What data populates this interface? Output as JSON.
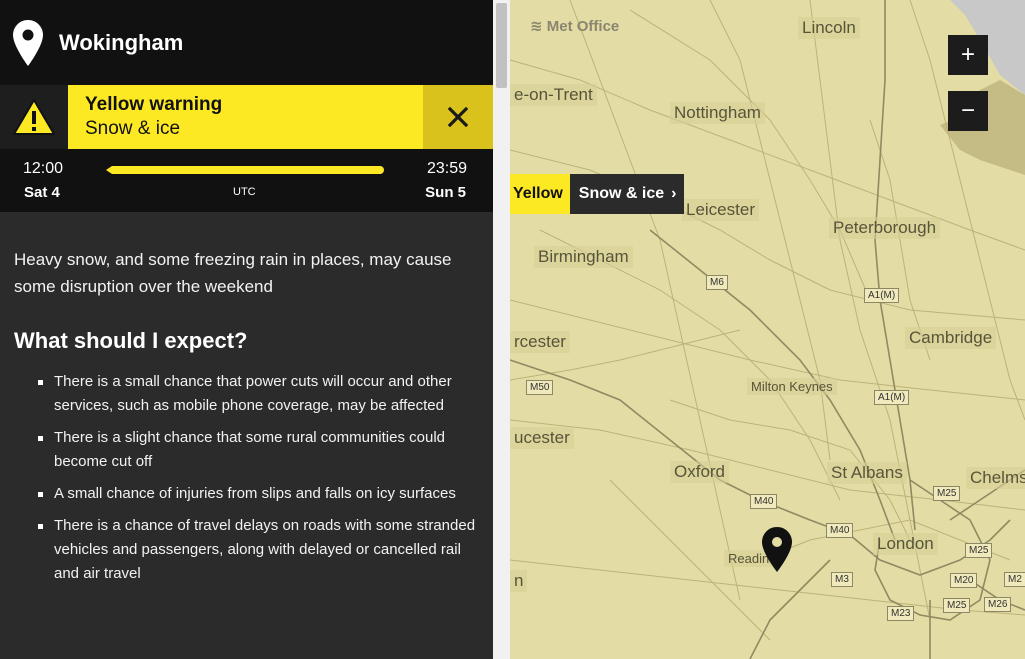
{
  "location": {
    "name": "Wokingham",
    "icon": "map-pin-icon"
  },
  "warning": {
    "level": "Yellow warning",
    "type": "Snow & ice",
    "icon": "warning-triangle-icon",
    "close_icon": "close-icon",
    "color": "#fde824"
  },
  "timeline": {
    "start_time": "12:00",
    "start_day": "Sat 4",
    "end_time": "23:59",
    "end_day": "Sun 5",
    "timezone": "UTC"
  },
  "summary": "Heavy snow, and some freezing rain in places, may cause some disruption over the weekend",
  "expect": {
    "heading": "What should I expect?",
    "items": [
      "There is a small chance that power cuts will occur and other services, such as mobile phone coverage, may be affected",
      "There is a slight chance that some rural communities could become cut off",
      "A small chance of injuries from slips and falls on icy surfaces",
      "There is a chance of travel delays on roads with some stranded vehicles and passengers, along with delayed or cancelled rail and air travel"
    ]
  },
  "map": {
    "brand": "Met Office",
    "zoom_in": "+",
    "zoom_out": "−",
    "chip": {
      "level": "Yellow",
      "type": "Snow & ice",
      "chevron": "›"
    },
    "cities": {
      "lincoln": "Lincoln",
      "trent": "e-on-Trent",
      "nottingham": "Nottingham",
      "leicester": "Leicester",
      "peterborough": "Peterborough",
      "birmingham": "Birmingham",
      "worcester": "rcester",
      "cambridge": "Cambridge",
      "milton_keynes": "Milton Keynes",
      "gloucester": "ucester",
      "oxford": "Oxford",
      "st_albans": "St Albans",
      "chelmsford": "Chelms",
      "london": "London",
      "reading": "Readin",
      "partial": "n"
    },
    "roads": {
      "m6": "M6",
      "a1m_1": "A1(M)",
      "a1m_2": "A1(M)",
      "m50": "M50",
      "m40_1": "M40",
      "m40_2": "M40",
      "m25_1": "M25",
      "m25_2": "M25",
      "m25_3": "M25",
      "m3": "M3",
      "m20": "M20",
      "m23": "M23",
      "m26": "M26",
      "m2": "M2"
    }
  }
}
